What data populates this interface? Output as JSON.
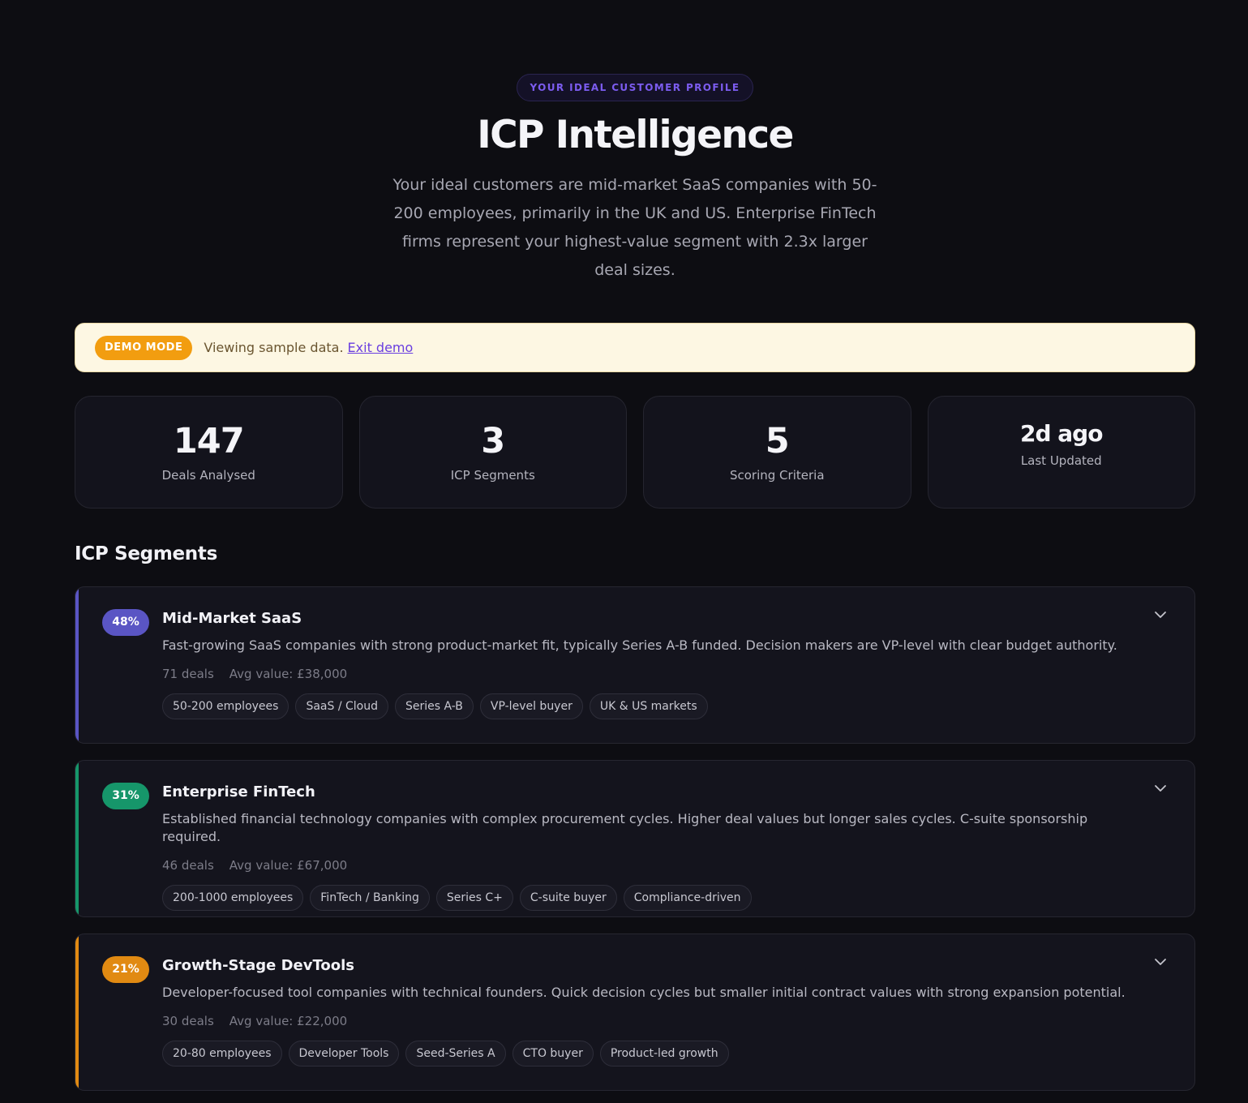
{
  "hero": {
    "eyebrow": "YOUR IDEAL CUSTOMER PROFILE",
    "title": "ICP Intelligence",
    "description": "Your ideal customers are mid-market SaaS companies with 50-200 employees, primarily in the UK and US. Enterprise FinTech firms represent your highest-value segment with 2.3x larger deal sizes."
  },
  "demo": {
    "badge": "DEMO MODE",
    "text": "Viewing sample data.",
    "link": "Exit demo"
  },
  "stats": [
    {
      "value": "147",
      "label": "Deals Analysed"
    },
    {
      "value": "3",
      "label": "ICP Segments"
    },
    {
      "value": "5",
      "label": "Scoring Criteria"
    },
    {
      "value": "2d ago",
      "label": "Last Updated"
    }
  ],
  "segments_title": "ICP Segments",
  "segments": [
    {
      "percent": "48%",
      "name": "Mid-Market SaaS",
      "description": "Fast-growing SaaS companies with strong product-market fit, typically Series A-B funded. Decision makers are VP-level with clear budget authority.",
      "deals": "71 deals",
      "avg_value": "Avg value: £38,000",
      "tags": [
        "50-200 employees",
        "SaaS / Cloud",
        "Series A-B",
        "VP-level buyer",
        "UK & US markets"
      ],
      "color": "#5a55c4"
    },
    {
      "percent": "31%",
      "name": "Enterprise FinTech",
      "description": "Established financial technology companies with complex procurement cycles. Higher deal values but longer sales cycles. C-suite sponsorship required.",
      "deals": "46 deals",
      "avg_value": "Avg value: £67,000",
      "tags": [
        "200-1000 employees",
        "FinTech / Banking",
        "Series C+",
        "C-suite buyer",
        "Compliance-driven"
      ],
      "color": "#16966a"
    },
    {
      "percent": "21%",
      "name": "Growth-Stage DevTools",
      "description": "Developer-focused tool companies with technical founders. Quick decision cycles but smaller initial contract values with strong expansion potential.",
      "deals": "30 deals",
      "avg_value": "Avg value: £22,000",
      "tags": [
        "20-80 employees",
        "Developer Tools",
        "Seed-Series A",
        "CTO buyer",
        "Product-led growth"
      ],
      "color": "#e18a12"
    }
  ],
  "icons": {
    "expand": "chevron-down-icon"
  }
}
